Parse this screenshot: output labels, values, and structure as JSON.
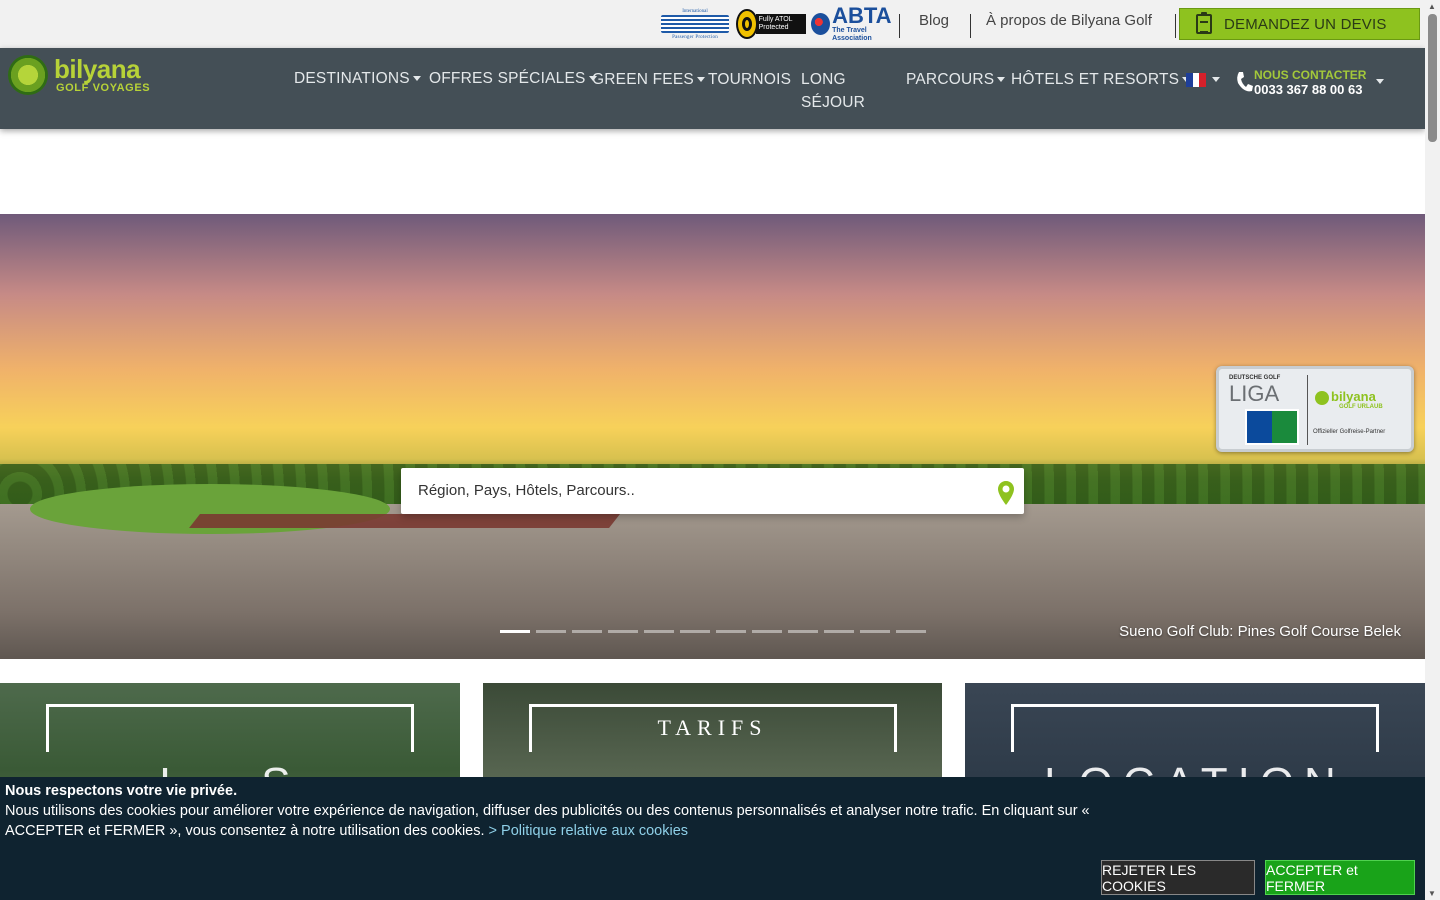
{
  "topbar": {
    "badges": {
      "ipp_top": "International",
      "ipp_caption": "Passenger Protection",
      "atol_label": "Fully ATOL Protected",
      "abta_name": "ABTA",
      "abta_sub": "The Travel Association"
    },
    "blog": "Blog",
    "about": "À propos de Bilyana Golf",
    "quote_button": "DEMANDEZ UN DEVIS"
  },
  "navbar": {
    "logo_name": "bilyana",
    "logo_sub": "GOLF VOYAGES",
    "items": [
      {
        "label": "DESTINATIONS",
        "dropdown": true
      },
      {
        "label": "OFFRES SPÉCIALES",
        "dropdown": true
      },
      {
        "label": "GREEN FEES",
        "dropdown": true
      },
      {
        "label": "TOURNOIS",
        "dropdown": false
      },
      {
        "label": "LONG",
        "dropdown": false
      },
      {
        "label": "SÉJOUR",
        "dropdown": false
      },
      {
        "label": "PARCOURS",
        "dropdown": true
      },
      {
        "label": "HÔTELS ET RESORTS",
        "dropdown": true
      }
    ],
    "language": "fr",
    "contact_label": "NOUS CONTACTER",
    "contact_phone": "0033 367 88 00 63"
  },
  "hero": {
    "search_placeholder": "Région, Pays, Hôtels, Parcours..",
    "caption": "Sueno Golf Club: Pines Golf Course Belek",
    "slides_total": 12,
    "active_slide": 1,
    "partner_badge": {
      "l1": "DEUTSCHE GOLF",
      "l2": "LIGA",
      "brand": "bilyana",
      "brand_sub": "GOLF URLAUB",
      "official": "Offizieller Golfreise-Partner"
    }
  },
  "tiles": [
    {
      "title": "",
      "big_title": "L · S"
    },
    {
      "title": "TARIFS",
      "big_title": ""
    },
    {
      "title": "",
      "big_title": "LOCATION CLUB"
    }
  ],
  "cookie": {
    "heading": "Nous respectons votre vie privée.",
    "text": "Nous utilisons des cookies pour améliorer votre expérience de navigation, diffuser des publicités ou des contenus personnalisés et analyser notre trafic. En cliquant sur « ACCEPTER et FERMER », vous consentez à notre utilisation des cookies.",
    "policy_link": "> Politique relative aux cookies",
    "reject_button": "REJETER LES COOKIES",
    "accept_button": "ACCEPTER et FERMER"
  },
  "colors": {
    "brand_green": "#8ec21f",
    "nav_bg": "#444f56",
    "cookie_bg": "#0f2330",
    "accept_green": "#19a319"
  }
}
